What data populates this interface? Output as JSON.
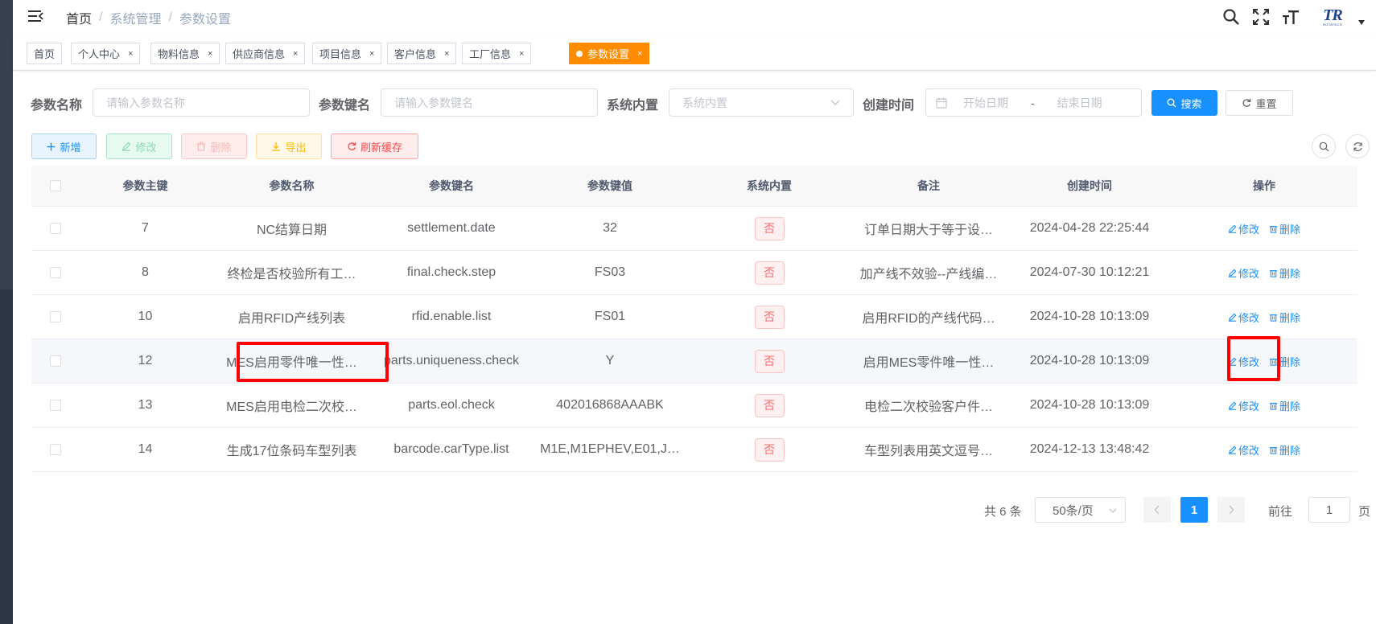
{
  "breadcrumb": {
    "home": "首页",
    "section": "系统管理",
    "current": "参数设置",
    "sep": "/"
  },
  "tags": [
    {
      "label": "首页",
      "closable": false
    },
    {
      "label": "个人中心",
      "closable": true
    },
    {
      "label": "物料信息",
      "closable": true
    },
    {
      "label": "供应商信息",
      "closable": true
    },
    {
      "label": "项目信息",
      "closable": true
    },
    {
      "label": "客户信息",
      "closable": true
    },
    {
      "label": "工厂信息",
      "closable": true
    },
    {
      "label": "参数设置",
      "closable": true,
      "active": true
    }
  ],
  "tag_close": "×",
  "search": {
    "name_label": "参数名称",
    "name_placeholder": "请输入参数名称",
    "key_label": "参数键名",
    "key_placeholder": "请输入参数键名",
    "builtin_label": "系统内置",
    "builtin_placeholder": "系统内置",
    "time_label": "创建时间",
    "start_placeholder": "开始日期",
    "range_sep": "-",
    "end_placeholder": "结束日期",
    "search_btn": "搜索",
    "reset_btn": "重置"
  },
  "toolbar": {
    "add": "新增",
    "edit": "修改",
    "delete": "删除",
    "export": "导出",
    "refresh_cache": "刷新缓存"
  },
  "table": {
    "columns": [
      "参数主键",
      "参数名称",
      "参数键名",
      "参数键值",
      "系统内置",
      "备注",
      "创建时间",
      "操作"
    ],
    "rows": [
      {
        "id": "7",
        "name": "NC结算日期",
        "key": "settlement.date",
        "value": "32",
        "builtin": "否",
        "remark": "订单日期大于等于设…",
        "created": "2024-04-28 22:25:44"
      },
      {
        "id": "8",
        "name": "终检是否校验所有工…",
        "key": "final.check.step",
        "value": "FS03",
        "builtin": "否",
        "remark": "加产线不效验--产线编…",
        "created": "2024-07-30 10:12:21"
      },
      {
        "id": "10",
        "name": "启用RFID产线列表",
        "key": "rfid.enable.list",
        "value": "FS01",
        "builtin": "否",
        "remark": "启用RFID的产线代码…",
        "created": "2024-10-28 10:13:09"
      },
      {
        "id": "12",
        "name": "MES启用零件唯一性…",
        "key": "parts.uniqueness.check",
        "value": "Y",
        "builtin": "否",
        "remark": "启用MES零件唯一性…",
        "created": "2024-10-28 10:13:09"
      },
      {
        "id": "13",
        "name": "MES启用电检二次校…",
        "key": "parts.eol.check",
        "value": "402016868AAABK",
        "builtin": "否",
        "remark": "电检二次校验客户件…",
        "created": "2024-10-28 10:13:09"
      },
      {
        "id": "14",
        "name": "生成17位条码车型列表",
        "key": "barcode.carType.list",
        "value": "M1E,M1EPHEV,E01,J…",
        "builtin": "否",
        "remark": "车型列表用英文逗号…",
        "created": "2024-12-13 13:48:42"
      }
    ],
    "op_edit": "修改",
    "op_delete": "删除"
  },
  "pagination": {
    "total": "共 6 条",
    "page_size": "50条/页",
    "current_page": "1",
    "goto_label": "前往",
    "goto_value": "1",
    "page_unit": "页"
  },
  "colors": {
    "primary": "#1890ff",
    "active_tag": "#ff8c00",
    "danger": "#f56c6c",
    "highlight": "#ff0000"
  }
}
